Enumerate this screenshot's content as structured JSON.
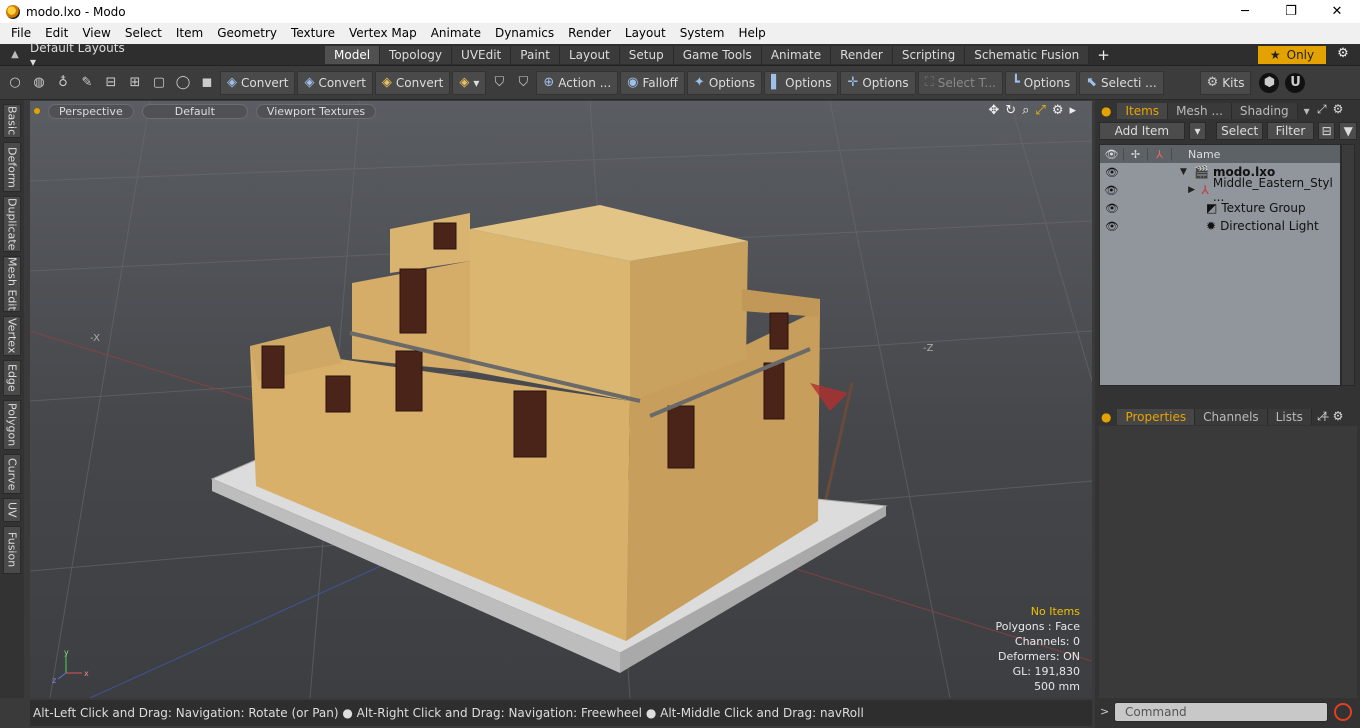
{
  "window": {
    "title": "modo.lxo - Modo",
    "minimize_glyph": "─",
    "maximize_glyph": "❐",
    "close_glyph": "✕"
  },
  "menu": [
    "File",
    "Edit",
    "View",
    "Select",
    "Item",
    "Geometry",
    "Texture",
    "Vertex Map",
    "Animate",
    "Dynamics",
    "Render",
    "Layout",
    "System",
    "Help"
  ],
  "layout_bar": {
    "layouts_label": "Default Layouts ▾",
    "tabs": [
      "Model",
      "Topology",
      "UVEdit",
      "Paint",
      "Layout",
      "Setup",
      "Game Tools",
      "Animate",
      "Render",
      "Scripting",
      "Schematic Fusion"
    ],
    "active_tab": "Model",
    "plus": "+",
    "only_label": "Only",
    "star": "★"
  },
  "toolbar": {
    "convert1": "Convert",
    "convert2": "Convert",
    "convert3": "Convert",
    "action": "Action ...",
    "falloff": "Falloff",
    "options1": "Options",
    "options2": "Options",
    "options3": "Options",
    "select_t": "Select T...",
    "options4": "Options",
    "selecti": "Selecti ...",
    "kits": "Kits"
  },
  "left_tabs": [
    "Basic",
    "Deform",
    "Duplicate",
    "Mesh Edit",
    "Vertex",
    "Edge",
    "Polygon",
    "Curve",
    "UV",
    "Fusion"
  ],
  "viewport": {
    "view": "Perspective",
    "shading": "Default",
    "textures": "Viewport Textures",
    "axis_x": "-X",
    "axis_z": "-Z",
    "stats": {
      "no_items": "No Items",
      "polygons": "Polygons : Face",
      "channels": "Channels: 0",
      "deformers": "Deformers: ON",
      "gl": "GL: 191,830",
      "scale": "500 mm"
    }
  },
  "status": "Alt-Left Click and Drag: Navigation: Rotate (or Pan) ● Alt-Right Click and Drag: Navigation: Freewheel ● Alt-Middle Click and Drag: navRoll",
  "items_panel": {
    "tabs": [
      "Items",
      "Mesh ...",
      "Shading"
    ],
    "add_item": "Add Item",
    "select": "Select",
    "filter": "Filter",
    "name_header": "Name",
    "rows": [
      {
        "name": "modo.lxo"
      },
      {
        "name": "Middle_Eastern_Styl ..."
      },
      {
        "name": "Texture Group"
      },
      {
        "name": "Directional Light"
      }
    ]
  },
  "props_panel": {
    "tabs": [
      "Properties",
      "Channels",
      "Lists"
    ],
    "plus": "+"
  },
  "command": {
    "placeholder": "Command",
    "arrow": ">"
  },
  "colors": {
    "accent": "#e3a200",
    "wall": "#d9b574",
    "base": "#d8d8d8"
  }
}
